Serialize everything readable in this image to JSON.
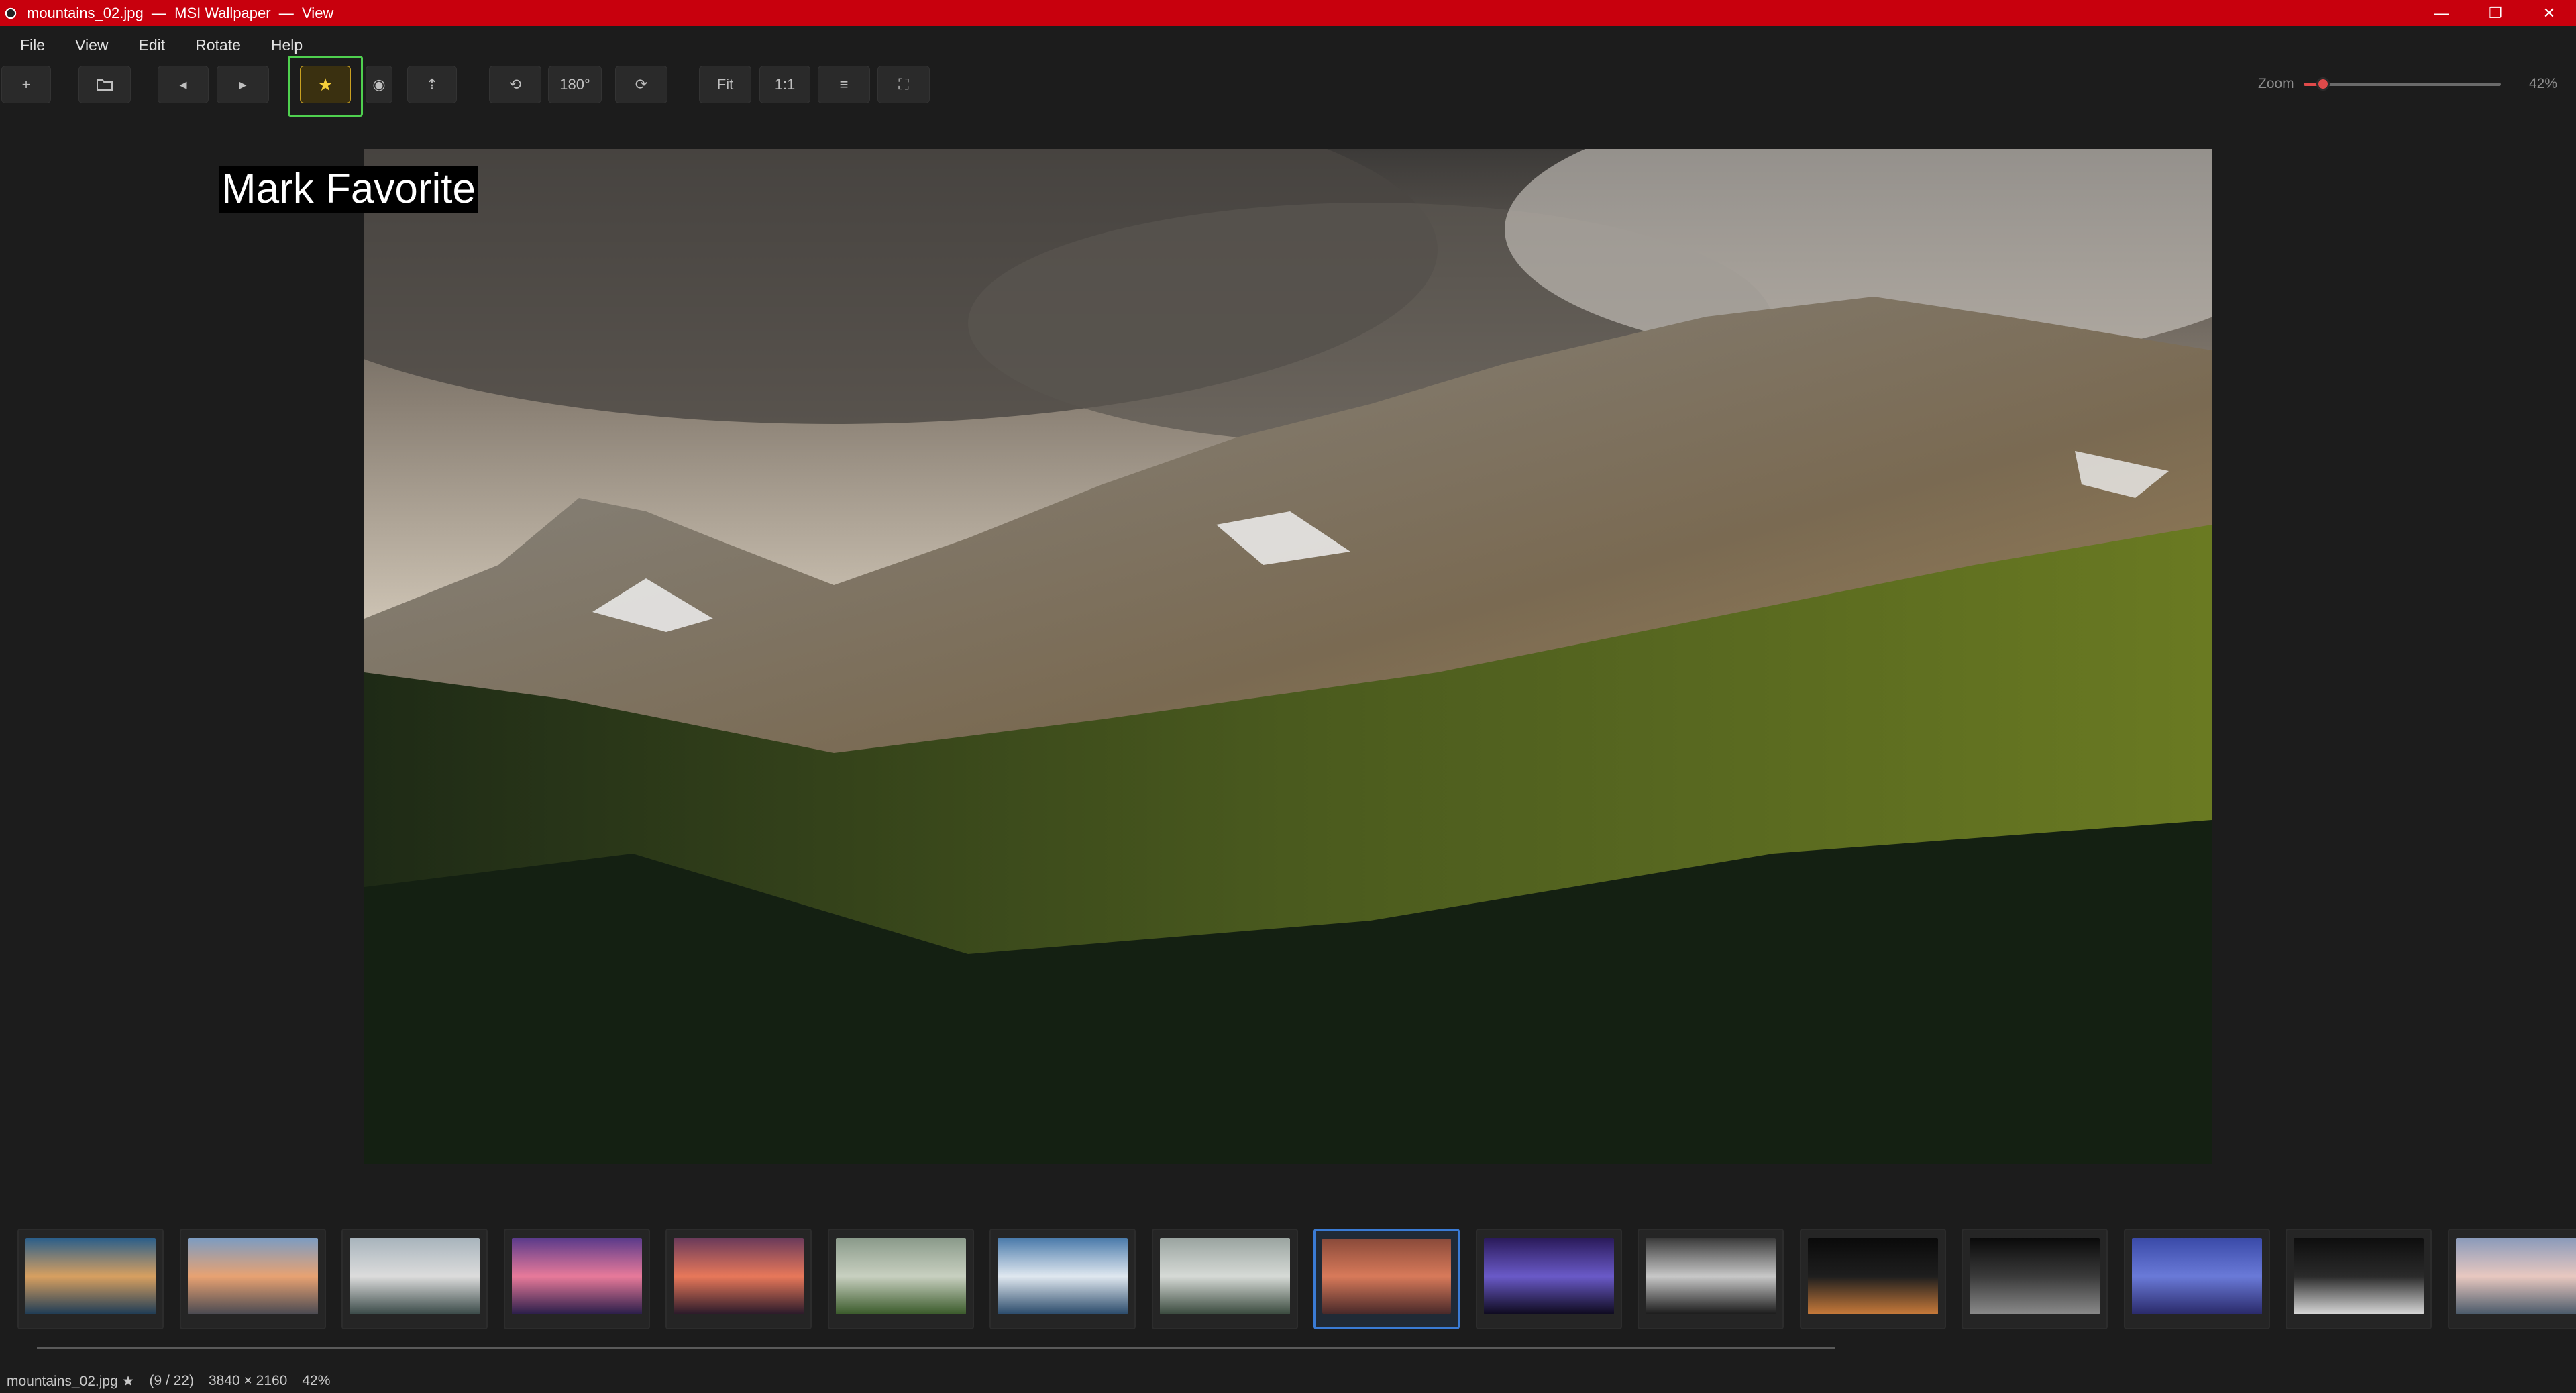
{
  "window": {
    "title": "mountains_02.jpg  —  MSI Wallpaper  —  View",
    "controls": {
      "minimize": "—",
      "maximize": "❐",
      "close": "✕"
    },
    "accent_color": "#c8000d"
  },
  "menu": {
    "items": [
      {
        "label": "File"
      },
      {
        "label": "View"
      },
      {
        "label": "Edit"
      },
      {
        "label": "Rotate"
      },
      {
        "label": "Help"
      }
    ]
  },
  "toolbar": {
    "add_icon": "+",
    "open_icon": "folder-open-icon",
    "prev_icon": "◂",
    "next_icon": "▸",
    "favorite_icon": "★",
    "favorite_tooltip": "Mark Favorite",
    "info_icon": "◉",
    "upload_icon": "⇡",
    "rotate_left_icon": "⟲",
    "rotate_180_label": "180°",
    "rotate_right_icon": "⟳",
    "fit_label": "Fit",
    "actual_size_label": "1:1",
    "list_icon": "≡",
    "fullscreen_icon": "⛶"
  },
  "zoom": {
    "label": "Zoom",
    "value_text": "42%",
    "level": 0.1,
    "color": "#e04a4a"
  },
  "thumbnails": [
    {
      "name": "lake-reflection",
      "colors": [
        "#2a5e8a",
        "#d8a060",
        "#1e3c56"
      ]
    },
    {
      "name": "coastal-rocks",
      "colors": [
        "#7c9cc2",
        "#e8a272",
        "#4a4a52"
      ]
    },
    {
      "name": "misty-hills",
      "colors": [
        "#a8b4bc",
        "#dcdcdc",
        "#3a4a48"
      ]
    },
    {
      "name": "purple-sunset",
      "colors": [
        "#5a3a8a",
        "#e87a9a",
        "#2a1e4a"
      ]
    },
    {
      "name": "orange-dusk",
      "colors": [
        "#6a3a5a",
        "#e8785a",
        "#2a1a2a"
      ]
    },
    {
      "name": "foggy-forest",
      "colors": [
        "#8a9a8a",
        "#c8d0c0",
        "#3a5a2a"
      ]
    },
    {
      "name": "ocean-coast",
      "colors": [
        "#4a7aaa",
        "#e0e8f0",
        "#2a4a6a"
      ]
    },
    {
      "name": "pine-fog",
      "colors": [
        "#9aa4a0",
        "#d6dad6",
        "#3a4a3e"
      ]
    },
    {
      "name": "mountains-02",
      "colors": [
        "#8a4a3a",
        "#d87a5a",
        "#4a2a2a"
      ]
    },
    {
      "name": "msi-stage",
      "colors": [
        "#2a1a5a",
        "#6a5ac8",
        "#0e0a1e"
      ]
    },
    {
      "name": "msi-silver",
      "colors": [
        "#3a3a3a",
        "#c8c8c8",
        "#1a1a1a"
      ]
    },
    {
      "name": "msi-pen",
      "colors": [
        "#0a0a0a",
        "#1e1e1e",
        "#c87a3a"
      ]
    },
    {
      "name": "msi-dark-drop",
      "colors": [
        "#0a0a0a",
        "#3a3a3a",
        "#8a8a8a"
      ]
    },
    {
      "name": "msi-blue-emblem",
      "colors": [
        "#3a4aa8",
        "#6a7ad8",
        "#2a2a6a"
      ]
    },
    {
      "name": "msi-laptop",
      "colors": [
        "#0e0e0e",
        "#2a2a2a",
        "#d8d8d8"
      ]
    },
    {
      "name": "beach-sunrise",
      "colors": [
        "#8a9aba",
        "#e8c8c0",
        "#4a5a6a"
      ]
    }
  ],
  "active_thumbnail_index": 8,
  "status": {
    "filename": "mountains_02.jpg ★",
    "position": "(9 / 22)",
    "dimensions": "3840 × 2160",
    "zoom": "42%"
  }
}
